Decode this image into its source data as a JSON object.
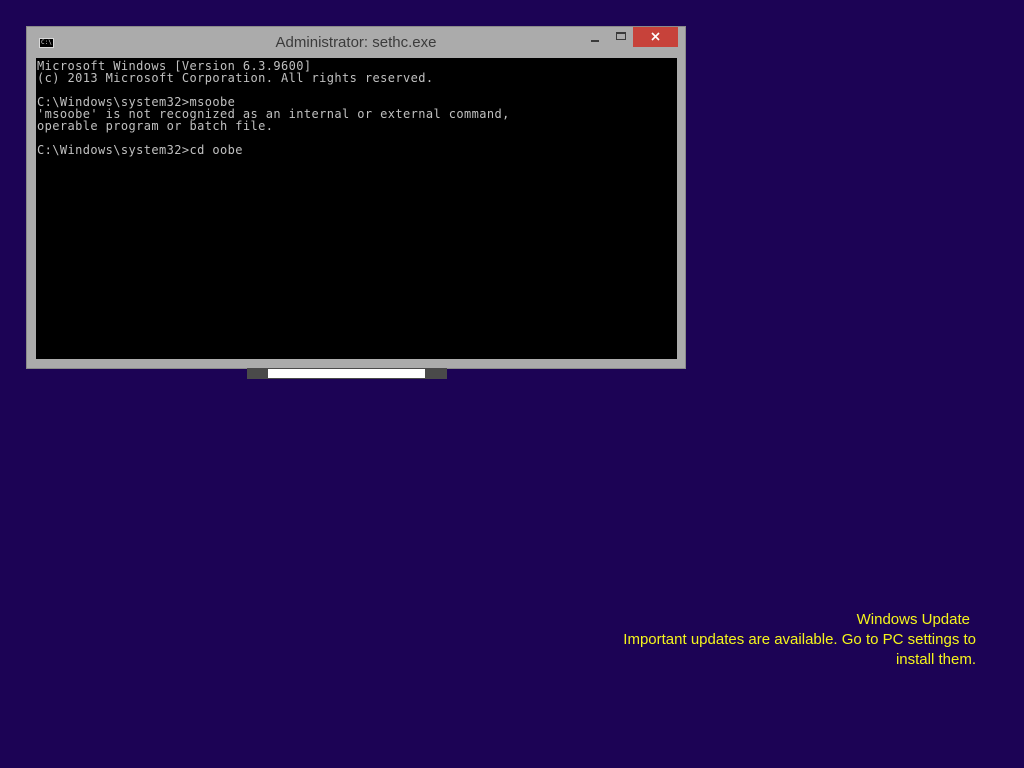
{
  "window": {
    "title": "Administrator: sethc.exe",
    "icon": "console-icon",
    "icon_text": "C:\\",
    "console_lines": [
      "Microsoft Windows [Version 6.3.9600]",
      "(c) 2013 Microsoft Corporation. All rights reserved.",
      "",
      "C:\\Windows\\system32>msoobe",
      "'msoobe' is not recognized as an internal or external command,",
      "operable program or batch file.",
      "",
      "C:\\Windows\\system32>cd oobe"
    ]
  },
  "notification": {
    "title": "Windows Update",
    "message_line1": "Important updates are available. Go to PC settings to",
    "message_line2": "install them."
  },
  "colors": {
    "desktop_background": "#1c0355",
    "notification_text": "#f5f51c",
    "close_button": "#c7423a",
    "console_background": "#000000",
    "console_text": "#c0c0c0"
  }
}
